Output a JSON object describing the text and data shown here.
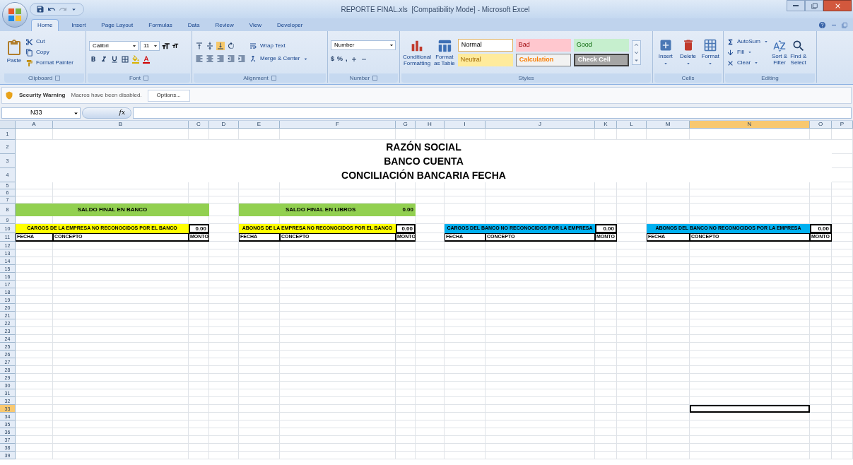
{
  "window": {
    "title": "REPORTE FINAL.xls  [Compatibility Mode] - Microsoft Excel"
  },
  "tabs": [
    {
      "label": "Home",
      "selected": true
    },
    {
      "label": "Insert",
      "selected": false
    },
    {
      "label": "Page Layout",
      "selected": false
    },
    {
      "label": "Formulas",
      "selected": false
    },
    {
      "label": "Data",
      "selected": false
    },
    {
      "label": "Review",
      "selected": false
    },
    {
      "label": "View",
      "selected": false
    },
    {
      "label": "Developer",
      "selected": false
    }
  ],
  "clipboard": {
    "paste": "Paste",
    "cut": "Cut",
    "copy": "Copy",
    "format_painter": "Format Painter",
    "label": "Clipboard"
  },
  "font": {
    "name": "Calibri",
    "size": "11",
    "label": "Font"
  },
  "alignment": {
    "wrap": "Wrap Text",
    "merge": "Merge & Center",
    "label": "Alignment"
  },
  "number": {
    "format": "Number",
    "symbols": [
      "$",
      "%",
      ","
    ],
    "label": "Number"
  },
  "styles": {
    "conditional": [
      "Conditional",
      "Formatting"
    ],
    "format_table": [
      "Format",
      "as Table"
    ],
    "label": "Styles",
    "gallery": [
      {
        "label": "Normal",
        "kind": "normal"
      },
      {
        "label": "Bad",
        "kind": "bad"
      },
      {
        "label": "Good",
        "kind": "good"
      },
      {
        "label": "Neutral",
        "kind": "neutral"
      },
      {
        "label": "Calculation",
        "kind": "calculation"
      },
      {
        "label": "Check Cell",
        "kind": "check"
      }
    ]
  },
  "cells": {
    "buttons": [
      "Insert",
      "Delete",
      "Format"
    ],
    "label": "Cells"
  },
  "editing": {
    "autosum": "AutoSum",
    "fill": "Fill",
    "clear": "Clear",
    "sort": [
      "Sort &",
      "Filter"
    ],
    "find": [
      "Find &",
      "Select"
    ],
    "label": "Editing"
  },
  "security": {
    "title": "Security Warning",
    "message": "Macros have been disabled.",
    "button": "Options..."
  },
  "formula_bar": {
    "name_box": "N33",
    "function_label": "fx"
  },
  "sheet": {
    "columns": [
      {
        "label": "A",
        "selected": false
      },
      {
        "label": "B",
        "selected": false
      },
      {
        "label": "C",
        "selected": false
      },
      {
        "label": "D",
        "selected": false
      },
      {
        "label": "E",
        "selected": false
      },
      {
        "label": "F",
        "selected": false
      },
      {
        "label": "G",
        "selected": false
      },
      {
        "label": "H",
        "selected": false
      },
      {
        "label": "I",
        "selected": false
      },
      {
        "label": "J",
        "selected": false
      },
      {
        "label": "K",
        "selected": false
      },
      {
        "label": "L",
        "selected": false
      },
      {
        "label": "M",
        "selected": false
      },
      {
        "label": "N",
        "selected": true
      },
      {
        "label": "O",
        "selected": false
      },
      {
        "label": "P",
        "selected": false
      }
    ],
    "rows": [
      {
        "label": "1",
        "selected": false
      },
      {
        "label": "2",
        "selected": false
      },
      {
        "label": "3",
        "selected": false
      },
      {
        "label": "4",
        "selected": false
      },
      {
        "label": "5",
        "selected": false
      },
      {
        "label": "6",
        "selected": false
      },
      {
        "label": "7",
        "selected": false
      },
      {
        "label": "8",
        "selected": false
      },
      {
        "label": "9",
        "selected": false
      },
      {
        "label": "10",
        "selected": false
      },
      {
        "label": "11",
        "selected": false
      },
      {
        "label": "12",
        "selected": false
      },
      {
        "label": "13",
        "selected": false
      },
      {
        "label": "14",
        "selected": false
      },
      {
        "label": "15",
        "selected": false
      },
      {
        "label": "16",
        "selected": false
      },
      {
        "label": "17",
        "selected": false
      },
      {
        "label": "18",
        "selected": false
      },
      {
        "label": "19",
        "selected": false
      },
      {
        "label": "20",
        "selected": false
      },
      {
        "label": "21",
        "selected": false
      },
      {
        "label": "22",
        "selected": false
      },
      {
        "label": "23",
        "selected": false
      },
      {
        "label": "24",
        "selected": false
      },
      {
        "label": "25",
        "selected": false
      },
      {
        "label": "26",
        "selected": false
      },
      {
        "label": "27",
        "selected": false
      },
      {
        "label": "28",
        "selected": false
      },
      {
        "label": "29",
        "selected": false
      },
      {
        "label": "30",
        "selected": false
      },
      {
        "label": "31",
        "selected": false
      },
      {
        "label": "32",
        "selected": false
      },
      {
        "label": "33",
        "selected": true
      },
      {
        "label": "34",
        "selected": false
      },
      {
        "label": "35",
        "selected": false
      },
      {
        "label": "36",
        "selected": false
      },
      {
        "label": "37",
        "selected": false
      },
      {
        "label": "38",
        "selected": false
      },
      {
        "label": "39",
        "selected": false
      }
    ],
    "report": {
      "titles": [
        "RAZÓN SOCIAL",
        "BANCO CUENTA",
        "CONCILIACIÓN BANCARIA FECHA"
      ],
      "balances": [
        {
          "label": "SALDO FINAL EN BANCO",
          "color": "#92d050"
        },
        {
          "label": "SALDO FINAL EN LIBROS",
          "value": "0.00",
          "color": "#92d050"
        }
      ],
      "tables": [
        {
          "title": "CARGOS DE LA EMPRESA NO RECONOCIDOS POR EL BANCO",
          "total": "0.00",
          "color": "#ffff00",
          "columns": [
            "FECHA",
            "CONCEPTO",
            "MONTO"
          ]
        },
        {
          "title": "ABONOS DE LA EMPRESA NO RECONOCIDOS POR EL BANCO",
          "total": "0.00",
          "color": "#ffff00",
          "columns": [
            "FECHA",
            "CONCEPTO",
            "MONTO"
          ]
        },
        {
          "title": "CARGOS DEL BANCO NO RECONOCIDOS POR LA EMPRESA",
          "total": "0.00",
          "color": "#00b0f0",
          "columns": [
            "FECHA",
            "CONCEPTO",
            "MONTO"
          ]
        },
        {
          "title": "ABONOS DEL BANCO NO RECONOCIDOS POR LA EMPRESA",
          "total": "0.00",
          "color": "#00b0f0",
          "columns": [
            "FECHA",
            "CONCEPTO",
            "MONTO"
          ]
        }
      ]
    }
  }
}
